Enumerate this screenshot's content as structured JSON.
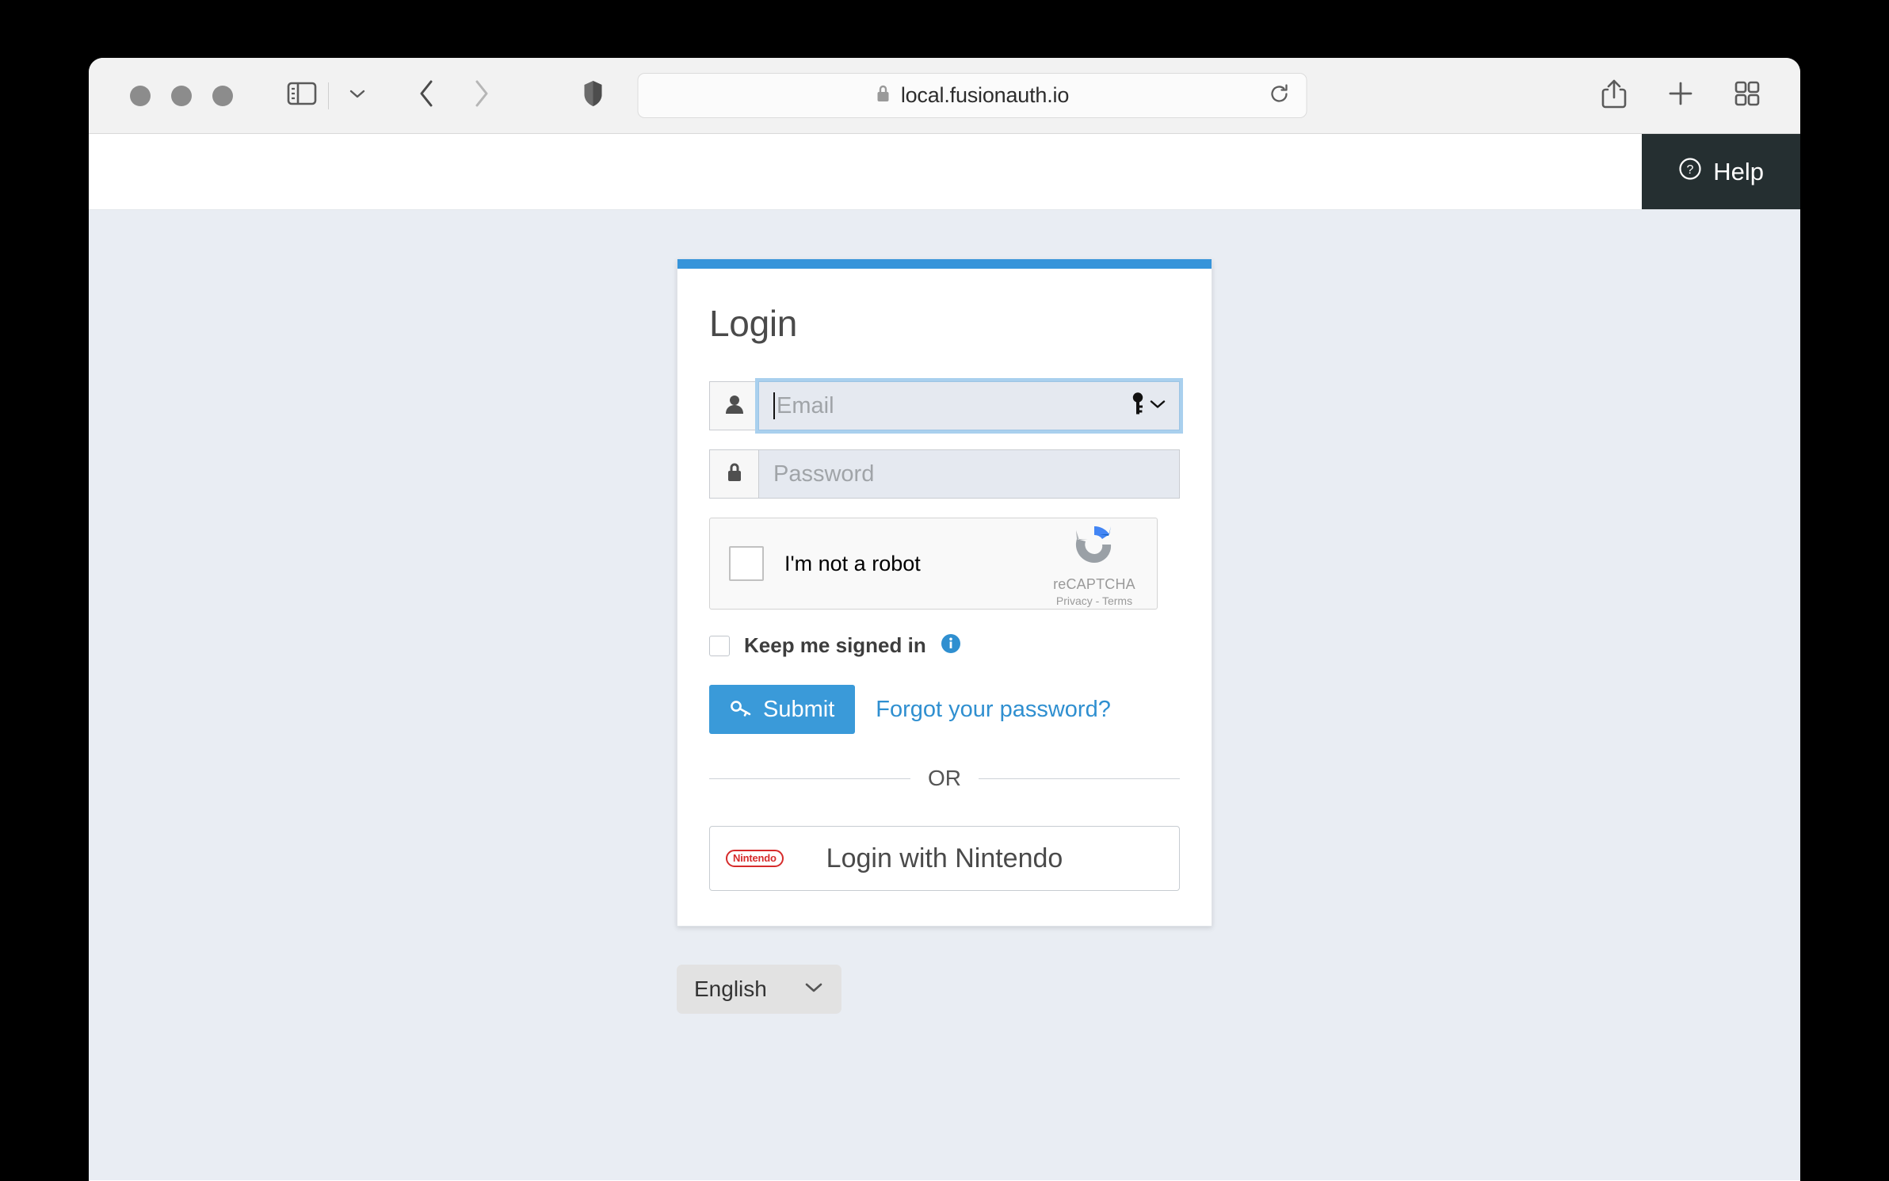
{
  "browser": {
    "traffic_lights": [
      "close",
      "minimize",
      "maximize"
    ],
    "url": "local.fusionauth.io",
    "lock_icon": "lock-icon",
    "sidebar_icon": "sidebar-toggle-icon",
    "back_icon": "back-chevron-icon",
    "forward_icon": "forward-chevron-icon",
    "shield_icon": "privacy-shield-icon",
    "reload_icon": "reload-icon",
    "share_icon": "share-icon",
    "new_tab_icon": "plus-icon",
    "tab_overview_icon": "tab-overview-icon"
  },
  "header": {
    "help_label": "Help",
    "help_icon": "question-circle-icon"
  },
  "login": {
    "title": "Login",
    "accent_color": "#3694da",
    "email": {
      "placeholder": "Email",
      "value": "",
      "addon_icon": "user-icon",
      "autofill_icon": "key-icon",
      "autofill_chevron": "chevron-down-icon",
      "focused": true
    },
    "password": {
      "placeholder": "Password",
      "value": "",
      "addon_icon": "lock-icon"
    },
    "recaptcha": {
      "label": "I'm not a robot",
      "brand": "reCAPTCHA",
      "links": "Privacy - Terms",
      "checked": false
    },
    "keep_signed_in": {
      "label": "Keep me signed in",
      "checked": false,
      "info_icon": "info-icon"
    },
    "submit": {
      "label": "Submit",
      "icon": "key-icon",
      "color": "#3a9ad9"
    },
    "forgot_password": "Forgot your password?",
    "divider": "OR",
    "idp": {
      "label": "Login with Nintendo",
      "logo_text": "Nintendo",
      "logo_color": "#d62b2b"
    }
  },
  "language": {
    "selected": "English",
    "chevron_icon": "chevron-down-icon"
  }
}
